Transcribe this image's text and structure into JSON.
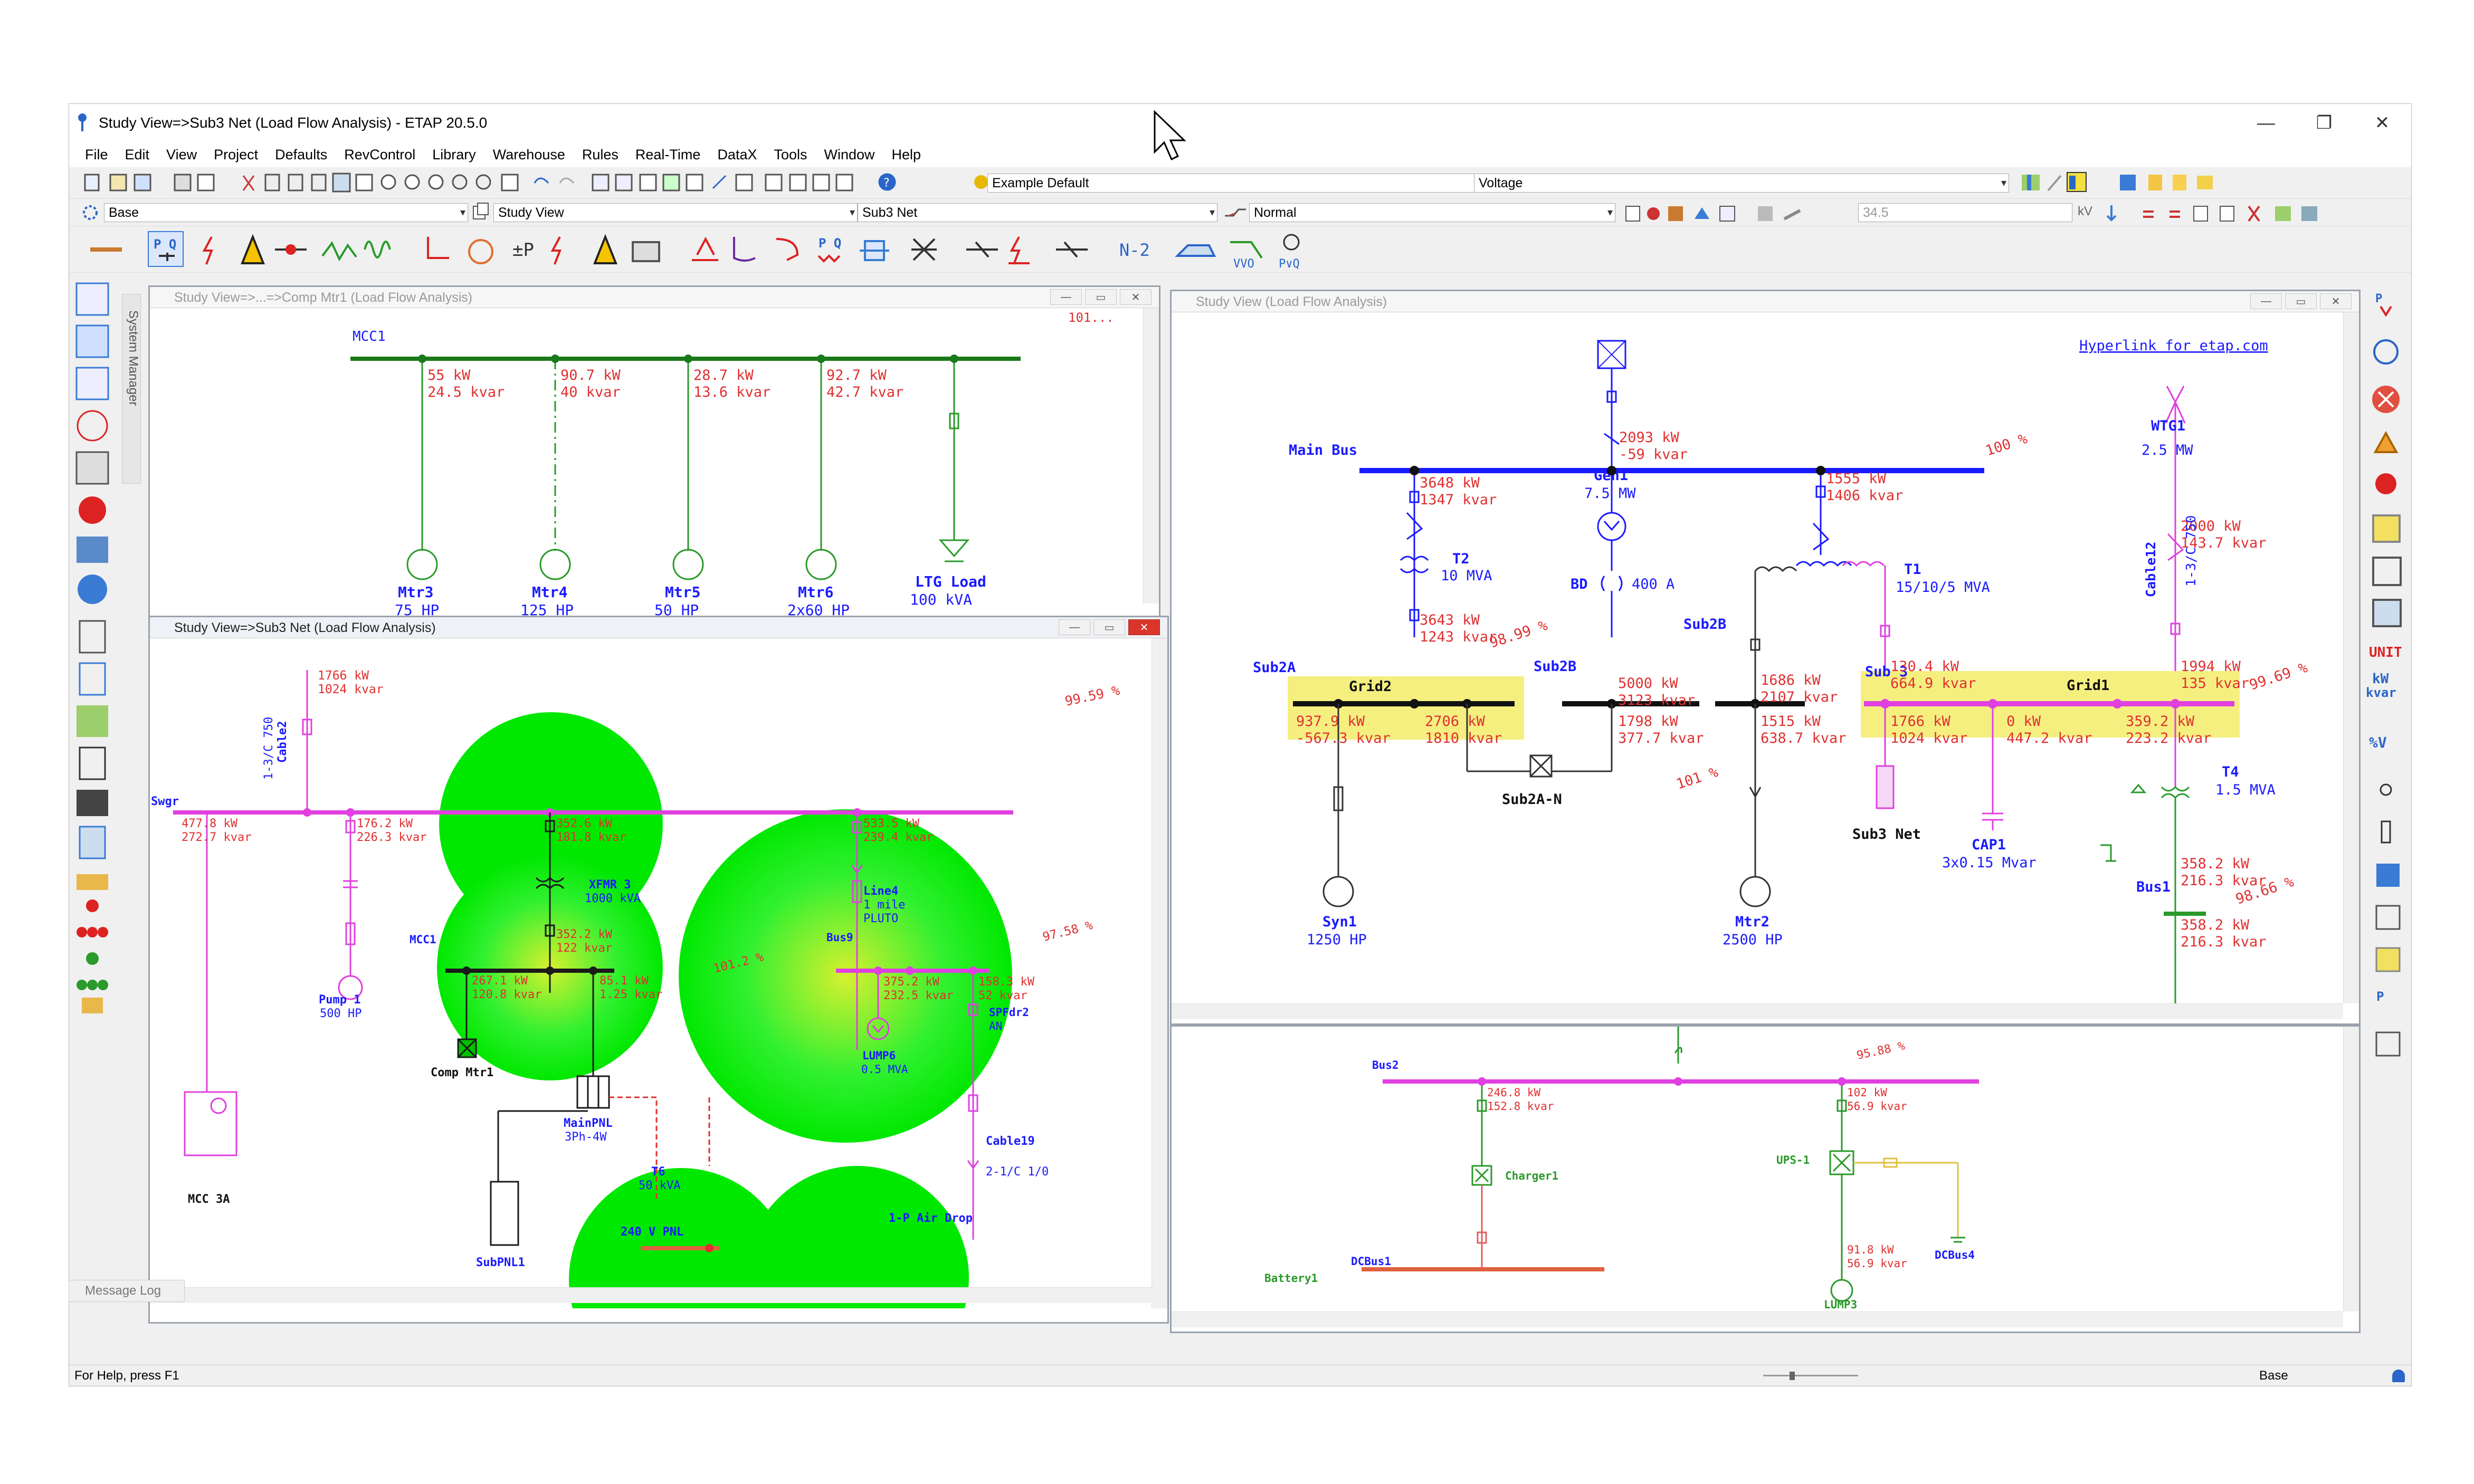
{
  "app": {
    "title": "Study View=>Sub3 Net (Load Flow Analysis) - ETAP 20.5.0",
    "brand_color": "#2a66c9"
  },
  "menu": [
    "File",
    "Edit",
    "View",
    "Project",
    "Defaults",
    "RevControl",
    "Library",
    "Warehouse",
    "Rules",
    "Real-Time",
    "DataX",
    "Tools",
    "Window",
    "Help"
  ],
  "toolbar": {
    "library_combo": "Example Default",
    "display_combo": "Voltage",
    "presentation_combo": "Base",
    "study_combo": "Study View",
    "network_combo": "Sub3 Net",
    "config_combo": "Normal",
    "kv_value": "34.5",
    "kv_unit": "kV",
    "n2_label": "N-2",
    "vvo_label": "VVO",
    "pvq_label": "P∨Q"
  },
  "system_manager": {
    "label": "System Manager"
  },
  "windows": {
    "comp_mtr1": {
      "title": "Study View=>...=>Comp Mtr1 (Load Flow Analysis)",
      "bus": "MCC1",
      "top_right": "101...",
      "branches": [
        {
          "kw": "55 kW",
          "kvar": "24.5 kvar",
          "name": "Mtr3",
          "rating": "75 HP"
        },
        {
          "kw": "90.7 kW",
          "kvar": "40 kvar",
          "name": "Mtr4",
          "rating": "125 HP"
        },
        {
          "kw": "28.7 kW",
          "kvar": "13.6 kvar",
          "name": "Mtr5",
          "rating": "50 HP"
        },
        {
          "kw": "92.7 kW",
          "kvar": "42.7 kvar",
          "name": "Mtr6",
          "rating": "2x60 HP"
        },
        {
          "kw": "",
          "kvar": "",
          "name": "LTG Load",
          "rating": "100 kVA"
        }
      ]
    },
    "sub3": {
      "title": "Study View=>Sub3 Net (Load Flow Analysis)",
      "cable_top": {
        "name": "Cable2",
        "spec": "1-3/C 750",
        "kw": "1766 kW",
        "kvar": "1024 kvar"
      },
      "voltage_top": "99.59 %",
      "swgr": "Swgr",
      "swgr_flows": [
        {
          "kw": "477.8 kW",
          "kvar": "272.7 kvar"
        },
        {
          "kw": "176.2 kW",
          "kvar": "226.3 kvar"
        },
        {
          "kw": "352.6 kW",
          "kvar": "181.8 kvar"
        },
        {
          "kw": "533.5 kW",
          "kvar": "239.4 kvar"
        }
      ],
      "xfmr3": {
        "name": "XFMR 3",
        "rating": "1000 kVA",
        "kw": "352.2 kW",
        "kvar": "122 kvar"
      },
      "mcc1": {
        "name": "MCC1",
        "v": "101.2 %",
        "flow1_kw": "267.1 kW",
        "flow1_kvar": "120.8 kvar",
        "flow2_kw": "85.1 kW",
        "flow2_kvar": "1.25 kvar"
      },
      "pump": {
        "name": "Pump 1",
        "rating": "500 HP"
      },
      "mcc3a": "MCC 3A",
      "comp_mtr1": "Comp Mtr1",
      "mainpnl": {
        "name": "MainPNL",
        "spec": "3Ph-4W"
      },
      "subpnl": "SubPNL1",
      "t6": {
        "name": "T6",
        "rating": "50 kVA",
        "pnl": "240 V PNL"
      },
      "line4": {
        "name": "Line4",
        "len": "1 mile",
        "type": "PLUTO"
      },
      "bus9": {
        "name": "Bus9",
        "v": "97.58 %",
        "flow1_kw": "375.2 kW",
        "flow1_kvar": "232.5 kvar",
        "flow2_kw": "158.3 kW",
        "flow2_kvar": "52 kvar"
      },
      "lump6": {
        "name": "LUMP6",
        "rating": "0.5 MVA"
      },
      "spfdr2": {
        "name": "SPFdr2",
        "sub": "AN"
      },
      "cable19": {
        "name": "Cable19",
        "spec": "2-1/C 1/0"
      },
      "airdrop": "1-P Air Drop"
    },
    "main_study": {
      "title": "Study View (Load Flow Analysis)",
      "hyperlink": "Hyperlink for etap.com",
      "main_bus": "Main Bus",
      "main_bus_v": "100 %",
      "utility_flow": {
        "kw": "2093 kW",
        "kvar": "-59 kvar"
      },
      "gen1": {
        "name": "Gen1",
        "rating": "7.5 MW"
      },
      "bd": {
        "name": "BD",
        "rating": "400 A"
      },
      "wtg1": {
        "name": "WTG1",
        "rating": "2.5 MW",
        "kw": "2000 kW",
        "kvar": "143.7 kvar"
      },
      "cable12": {
        "name": "Cable12",
        "spec": "1-3/C 750"
      },
      "t2": {
        "name": "T2",
        "rating": "10 MVA",
        "kw": "3648 kW",
        "kvar": "1347 kvar",
        "lo_kw": "3643 kW",
        "lo_kvar": "1243 kvar"
      },
      "t1": {
        "name": "T1",
        "rating": "15/10/5 MVA",
        "kw": "1555 kW",
        "kvar": "1406 kvar"
      },
      "sub2a": "Sub2A",
      "sub2b_top": "Sub2B",
      "sub2b": "Sub2B",
      "grid2": "Grid2",
      "grid2_v": "98.99 %",
      "grid2_flows": {
        "kw1": "937.9 kW",
        "kvar1": "-567.3 kvar",
        "kw2": "2706 kW",
        "kvar2": "1810 kvar"
      },
      "sub2b_flows": {
        "kw1": "5000 kW",
        "kvar1": "3123 kvar",
        "kw2": "1798 kW",
        "kvar2": "377.7 kvar"
      },
      "sub2b_right": {
        "kw1": "1686 kW",
        "kvar1": "2107 kvar",
        "kw2": "1515 kW",
        "kvar2": "638.7 kvar"
      },
      "v_101": "101 %",
      "sub3": "Sub 3",
      "grid1": "Grid1",
      "grid1_v": "99.69 %",
      "grid1_top": {
        "kw1": "130.4 kW",
        "kvar1": "664.9 kvar",
        "kw2": "1994 kW",
        "kvar2": "135 kvar"
      },
      "grid1_bot": {
        "kw1": "1766 kW",
        "kvar1": "1024 kvar",
        "kw2": "0 kW",
        "kvar2": "447.2 kvar",
        "kw3": "359.2 kW",
        "kvar3": "223.2 kvar"
      },
      "syn1": {
        "name": "Syn1",
        "rating": "1250 HP"
      },
      "sub2a_n": "Sub2A-N",
      "mtr2": {
        "name": "Mtr2",
        "rating": "2500 HP"
      },
      "sub3net": "Sub3 Net",
      "cap1": {
        "name": "CAP1",
        "rating": "3x0.15 Mvar"
      },
      "t4": {
        "name": "T4",
        "rating": "1.5 MVA",
        "kw": "358.2 kW",
        "kvar": "216.3 kvar"
      },
      "bus1": {
        "name": "Bus1",
        "v": "98.66 %",
        "kw": "358.2 kW",
        "kvar": "216.3 kvar"
      }
    },
    "dc_view": {
      "bus2": "Bus2",
      "bus2_v": "95.88 %",
      "flow1": {
        "kw": "246.8 kW",
        "kvar": "152.8 kvar"
      },
      "flow2": {
        "kw": "102 kW",
        "kvar": "56.9 kvar"
      },
      "charger": "Charger1",
      "ups": "UPS-1",
      "battery": "Battery1",
      "dcbus1": "DCBus1",
      "dcbus4": "DCBus4",
      "lump3": {
        "name": "LUMP3",
        "kw": "91.8 kW",
        "kvar": "56.9 kvar"
      }
    }
  },
  "right_toolbar": {
    "unit_label": "UNIT",
    "kw_label": "kW",
    "kvar_label": "kvar",
    "pct_label": "%V"
  },
  "message_log": "Message Log",
  "status": {
    "help": "For Help, press F1",
    "presentation": "Base"
  }
}
